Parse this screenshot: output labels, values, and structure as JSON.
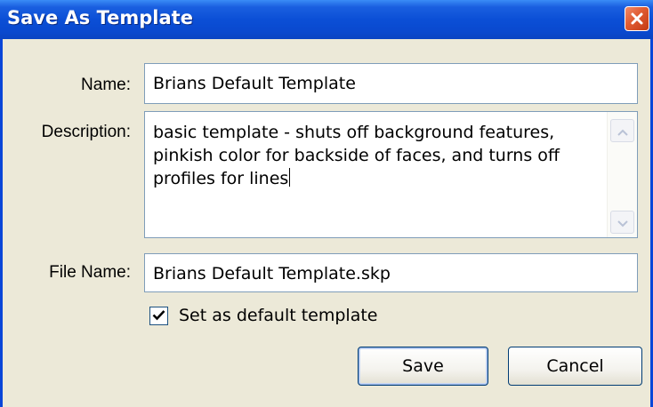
{
  "dialog": {
    "title": "Save As Template",
    "close_icon": "close-icon"
  },
  "form": {
    "name_label": "Name:",
    "name_value": "Brians Default Template",
    "description_label": "Description:",
    "description_value": "basic template - shuts off background features,\npinkish color for backside of faces, and turns off\nprofiles for lines",
    "filename_label": "File Name:",
    "filename_value": "Brians Default Template.skp",
    "default_checkbox_label": "Set as default template",
    "default_checked": true
  },
  "buttons": {
    "save_label": "Save",
    "cancel_label": "Cancel"
  },
  "colors": {
    "titlebar": "#0a49cf",
    "close_button": "#e05a30",
    "dialog_background": "#ece9d8",
    "field_border": "#7f9db9",
    "button_border": "#003c74"
  }
}
